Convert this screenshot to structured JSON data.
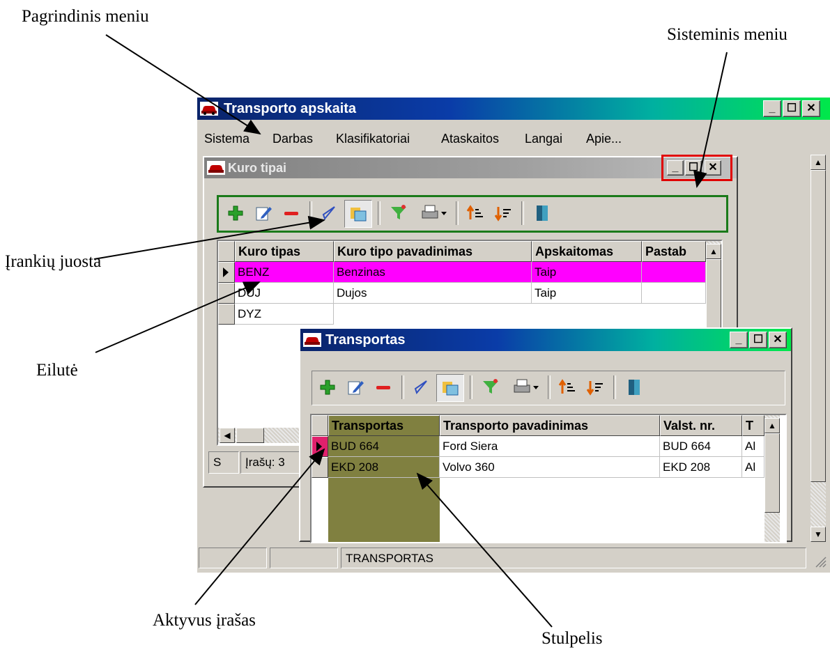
{
  "annotations": {
    "main_menu": "Pagrindinis meniu",
    "system_menu": "Sisteminis meniu",
    "toolbar": "Įrankių juosta",
    "row": "Eilutė",
    "active_record": "Aktyvus įrašas",
    "column": "Stulpelis"
  },
  "app": {
    "title": "Transporto apskaita",
    "menu": [
      "Sistema",
      "Darbas",
      "Klasifikatoriai",
      "Ataskaitos",
      "Langai",
      "Apie..."
    ]
  },
  "kuro_window": {
    "title": "Kuro tipai",
    "columns": [
      "Kuro tipas",
      "Kuro tipo pavadinimas",
      "Apskaitomas",
      "Pastab"
    ],
    "rows": [
      [
        "BENZ",
        "Benzinas",
        "Taip",
        ""
      ],
      [
        "DUJ",
        "Dujos",
        "Taip",
        ""
      ],
      [
        "DYZ",
        "",
        "",
        ""
      ]
    ],
    "status_left": "S",
    "status_records": "Įrašų: 3"
  },
  "transport_window": {
    "title": "Transportas",
    "columns": [
      "Transportas",
      "Transporto pavadinimas",
      "Valst. nr.",
      "T"
    ],
    "rows": [
      [
        "BUD 664",
        "Ford Siera",
        "BUD 664",
        "Al"
      ],
      [
        "EKD 208",
        "Volvo  360",
        "EKD 208",
        "Al"
      ]
    ]
  },
  "statusbar": {
    "text": "TRANSPORTAS"
  },
  "colors": {
    "selected_row": "#ff00ff",
    "active_column": "#808040",
    "toolbar_outline": "#1a7a1a",
    "sysmenu_outline": "#e00000"
  }
}
